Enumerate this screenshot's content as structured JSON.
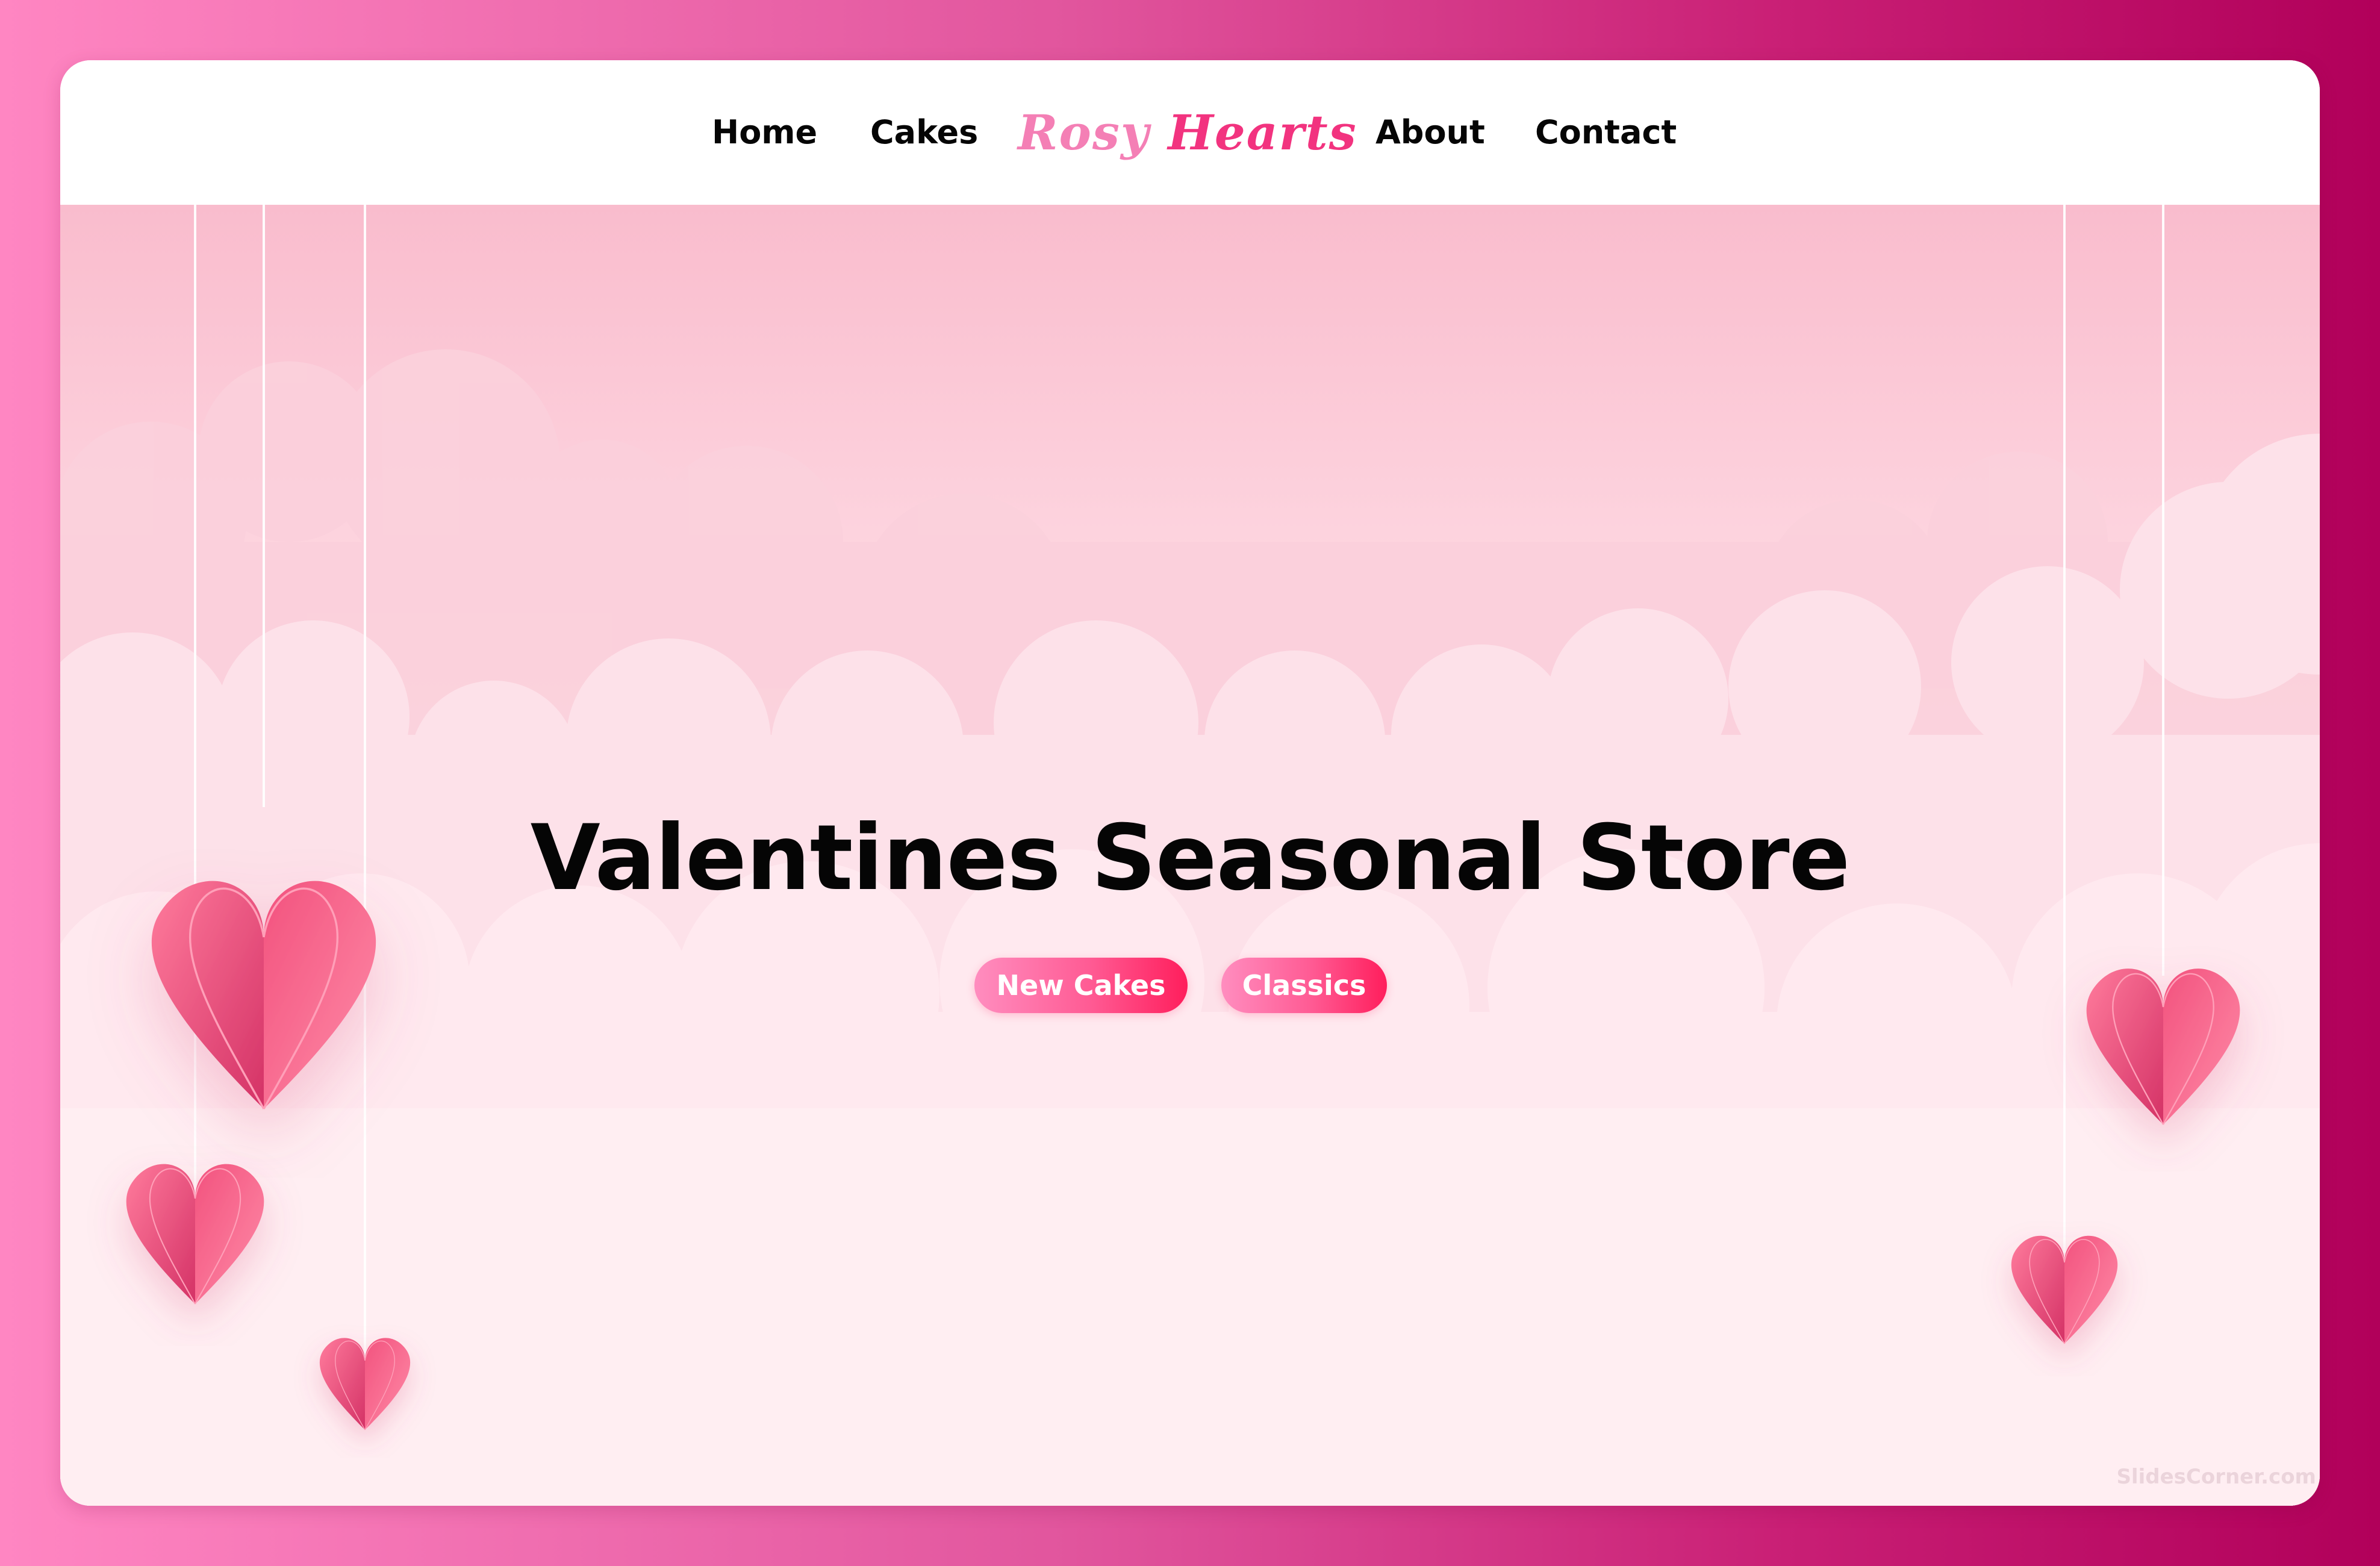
{
  "nav": {
    "home_label": "Home",
    "cakes_label": "Cakes",
    "brand_word1": "Rosy",
    "brand_word2": "Hearts",
    "about_label": "About",
    "contact_label": "Contact"
  },
  "hero": {
    "title": "Valentines Seasonal Store",
    "buttons": [
      {
        "label": "New Cakes"
      },
      {
        "label": "Classics"
      }
    ],
    "decorations": [
      "heart-icon",
      "cloud-shape",
      "hanging-string"
    ]
  },
  "watermark": "SlidesCorner.com",
  "colors": {
    "brand_light": "#f47fb5",
    "brand_dark": "#f2337f",
    "pill_start": "#ff8dbf",
    "pill_end": "#ff1e5c",
    "heart": "#f2507f",
    "sky_top": "#fcc7d6",
    "cloud": "#ffeef3"
  }
}
